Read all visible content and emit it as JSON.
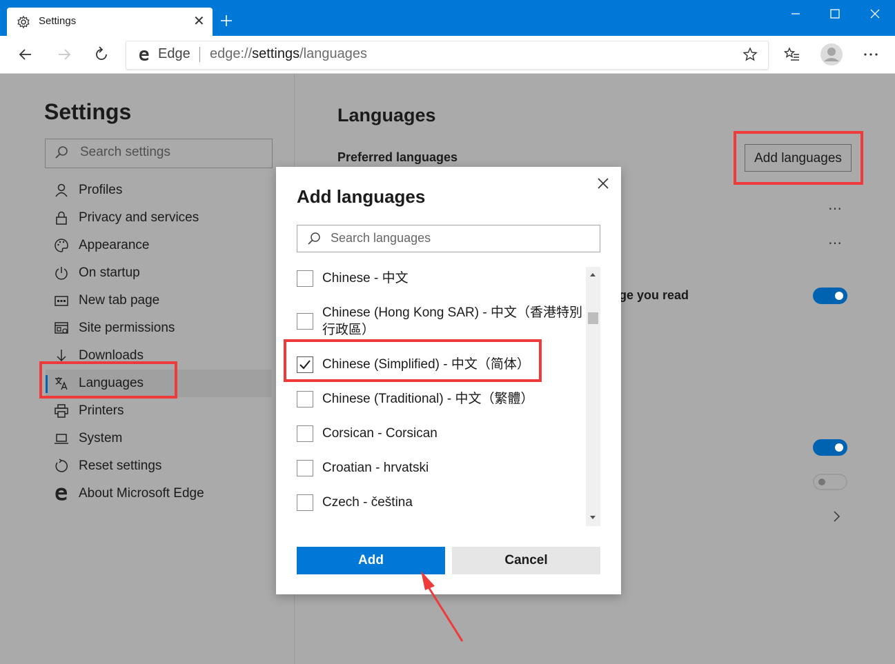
{
  "browser": {
    "tab_title": "Settings",
    "tab_close": "✕",
    "site_label": "Edge",
    "url_scheme": "edge://",
    "url_path": "settings",
    "url_rest": "/languages"
  },
  "sidebar": {
    "title": "Settings",
    "search_placeholder": "Search settings",
    "items": [
      {
        "label": "Profiles",
        "icon": "profile-icon"
      },
      {
        "label": "Privacy and services",
        "icon": "lock-icon"
      },
      {
        "label": "Appearance",
        "icon": "palette-icon"
      },
      {
        "label": "On startup",
        "icon": "power-icon"
      },
      {
        "label": "New tab page",
        "icon": "new-tab-page-icon"
      },
      {
        "label": "Site permissions",
        "icon": "site-permissions-icon"
      },
      {
        "label": "Downloads",
        "icon": "download-icon"
      },
      {
        "label": "Languages",
        "icon": "languages-icon",
        "active": true
      },
      {
        "label": "Printers",
        "icon": "printer-icon"
      },
      {
        "label": "System",
        "icon": "laptop-icon"
      },
      {
        "label": "Reset settings",
        "icon": "reset-icon"
      },
      {
        "label": "About Microsoft Edge",
        "icon": "edge-logo-icon"
      }
    ]
  },
  "main": {
    "title": "Languages",
    "preferred_languages": "Preferred languages",
    "add_languages_button": "Add languages",
    "dots": "⋯",
    "offer_translate_fragment": "ge you read"
  },
  "dialog": {
    "title": "Add languages",
    "search_placeholder": "Search languages",
    "languages": [
      {
        "label": "Chinese - 中文",
        "checked": false
      },
      {
        "label": "Chinese (Hong Kong SAR) - 中文（香港特別行政區）",
        "checked": false
      },
      {
        "label": "Chinese (Simplified) - 中文（简体）",
        "checked": true
      },
      {
        "label": "Chinese (Traditional) - 中文（繁體）",
        "checked": false
      },
      {
        "label": "Corsican - Corsican",
        "checked": false
      },
      {
        "label": "Croatian - hrvatski",
        "checked": false
      },
      {
        "label": "Czech - čeština",
        "checked": false
      }
    ],
    "add_button": "Add",
    "cancel_button": "Cancel"
  },
  "colors": {
    "accent": "#0078d7",
    "annotation": "#ee3a3a",
    "overlay": "#aaaaaa"
  }
}
